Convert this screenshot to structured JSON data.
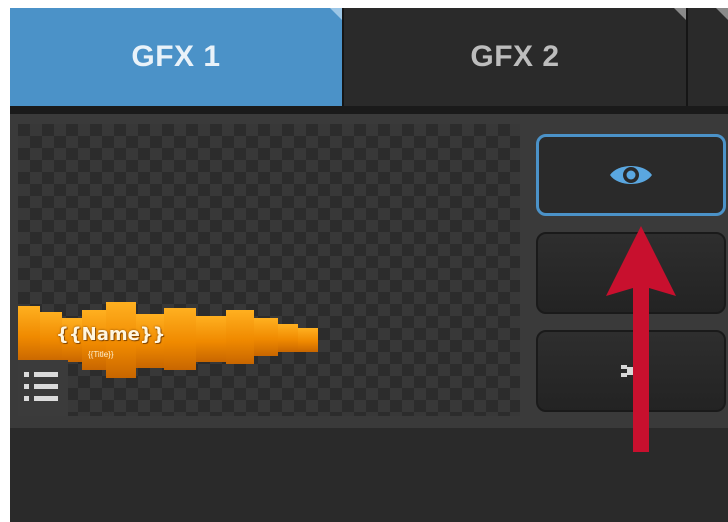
{
  "tabs": [
    {
      "label": "GFX 1",
      "active": true
    },
    {
      "label": "GFX 2",
      "active": false
    }
  ],
  "preview": {
    "graphic_name": "{{Name}}",
    "graphic_subtitle": "{{Title}}"
  },
  "side_buttons": [
    {
      "icon": "eye-icon",
      "selected": true
    },
    {
      "icon": "fit-icon",
      "selected": false
    },
    {
      "icon": "settings-icon",
      "selected": false
    }
  ],
  "colors": {
    "accent_blue": "#4b92c8",
    "annotation_red": "#c8102e",
    "lower_third_orange": "#f08a00"
  }
}
